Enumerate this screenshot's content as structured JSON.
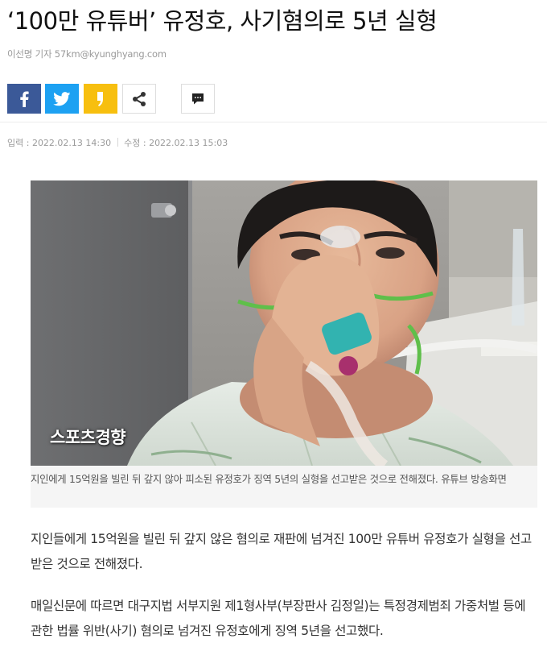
{
  "article": {
    "headline": "‘100만 유튜버’ 유정호, 사기혐의로 5년 실형",
    "byline": "이선명 기자 57km@kyunghyang.com",
    "published": "입력 : 2022.02.13 14:30",
    "modified": "수정 : 2022.02.13 15:03",
    "photo_watermark": "스포츠경향",
    "photo_caption": "지인에게 15억원을 빌린 뒤 갚지 않아 피소된 유정호가 징역 5년의 실형을 선고받은 것으로 전해졌다. 유튜브 방송화면",
    "paragraphs": [
      "지인들에게 15억원을 빌린 뒤 갚지 않은 혐의로 재판에 넘겨진 100만 유튜버 유정호가 실형을 선고받은 것으로 전해졌다.",
      "매일신문에 따르면 대구지법 서부지원 제1형사부(부장판사 김정일)는 특정경제범죄 가중처벌 등에 관한 법률 위반(사기) 혐의로 넘겨진 유정호에게 징역 5년을 선고했다."
    ]
  },
  "share": {
    "buttons": [
      {
        "name": "facebook",
        "icon": "facebook-icon",
        "color": "#3b5998"
      },
      {
        "name": "twitter",
        "icon": "twitter-icon",
        "color": "#1da1f2"
      },
      {
        "name": "kakaostory",
        "icon": "kakaostory-icon",
        "color": "#f7bf0f"
      },
      {
        "name": "share",
        "icon": "share-icon",
        "color": "#ffffff"
      },
      {
        "name": "comment",
        "icon": "comment-icon",
        "color": "#ffffff"
      }
    ]
  }
}
